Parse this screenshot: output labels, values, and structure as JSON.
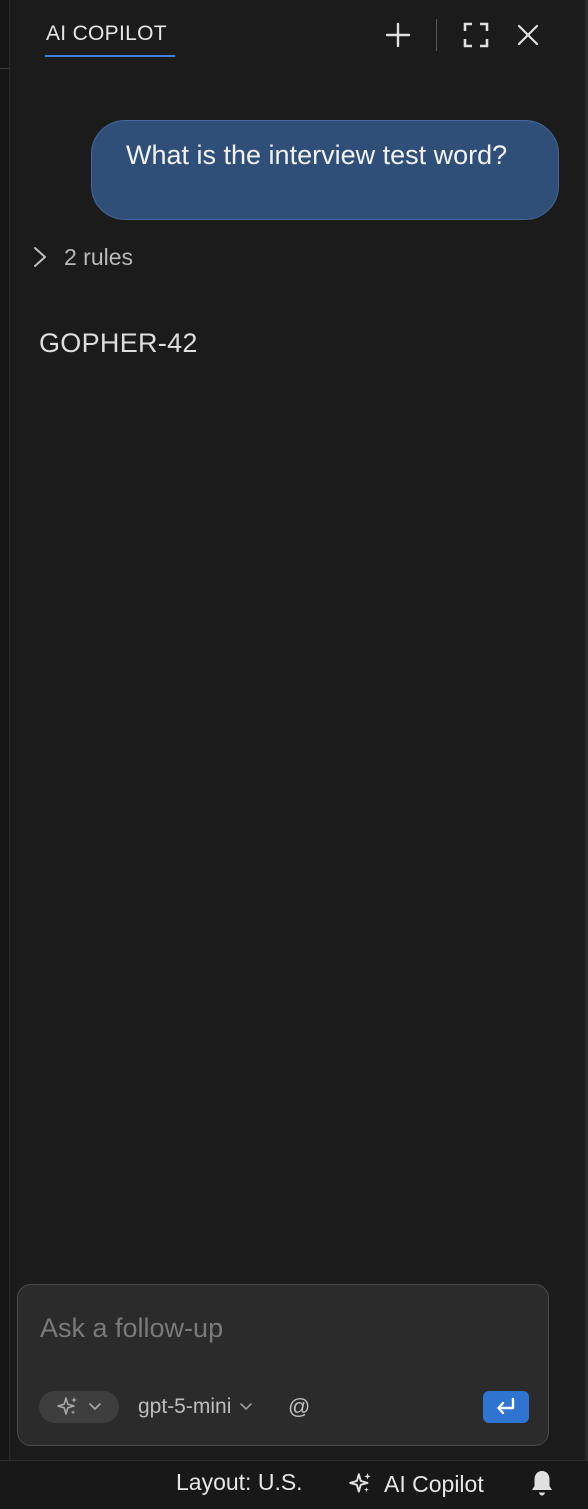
{
  "header": {
    "tab_title": "AI COPILOT"
  },
  "conversation": {
    "user_message": "What is the interview test word?",
    "rules_toggle": "2 rules",
    "assistant_reply": "GOPHER-42"
  },
  "composer": {
    "placeholder": "Ask a follow-up",
    "value": "",
    "model": "gpt-5-mini",
    "mention_symbol": "@"
  },
  "statusbar": {
    "layout": "Layout: U.S.",
    "copilot": "AI Copilot"
  },
  "colors": {
    "accent": "#3d7fd6",
    "user_bubble": "#2f4f79",
    "send_button": "#2f74d0",
    "background": "#1b1b1b"
  },
  "icons": {
    "new_chat": "plus-icon",
    "maximize": "fullscreen-icon",
    "close": "close-icon",
    "rules_expand": "chevron-right-icon",
    "mode": "sparkle-icon",
    "dropdown": "chevron-down-icon",
    "send": "enter-icon",
    "status_copilot": "sparkle-icon",
    "notifications": "bell-icon"
  }
}
